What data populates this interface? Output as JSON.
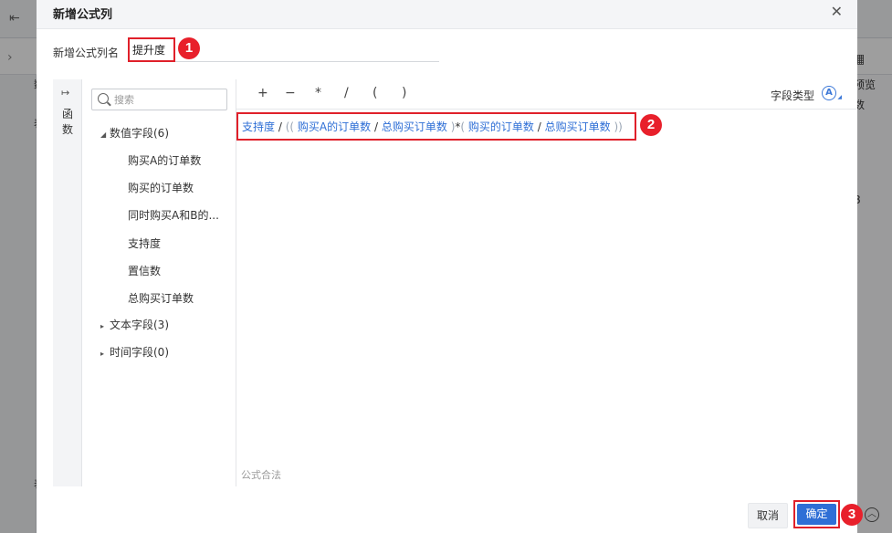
{
  "background": {
    "right_text_1": "预览",
    "right_text_2": "数",
    "right_num": "8",
    "left_chars": [
      "数",
      "表",
      "表"
    ]
  },
  "dialog": {
    "title": "新增公式列",
    "close_icon": "close-icon",
    "name_label": "新增公式列名",
    "name_value": "提升度",
    "function_tab": {
      "label": "函数"
    },
    "search": {
      "placeholder": "搜索"
    },
    "tree": {
      "numeric_group": "数值字段(6)",
      "numeric_fields": [
        "购买A的订单数",
        "购买的订单数",
        "同时购买A和B的...",
        "支持度",
        "置信数",
        "总购买订单数"
      ],
      "text_group": "文本字段(3)",
      "time_group": "时间字段(0)"
    },
    "toolbar": {
      "operators": [
        "+",
        "−",
        "*",
        "/",
        "(",
        ")"
      ],
      "field_type_label": "字段类型",
      "field_type_icon": "A"
    },
    "formula": {
      "t1": "支持度",
      "t2": "/",
      "t3": "((",
      "t4": "购买A的订单数",
      "t5": "/",
      "t6": "总购买订单数",
      "t7": ")",
      "t8": "*",
      "t9": "(",
      "t10": "购买的订单数",
      "t11": "/",
      "t12": "总购买订单数",
      "t13": "))"
    },
    "formula_status": "公式合法",
    "buttons": {
      "cancel": "取消",
      "ok": "确定"
    }
  },
  "annotations": [
    "1",
    "2",
    "3"
  ],
  "colors": {
    "accent": "#2f6fd6",
    "highlight": "#e0202a"
  }
}
